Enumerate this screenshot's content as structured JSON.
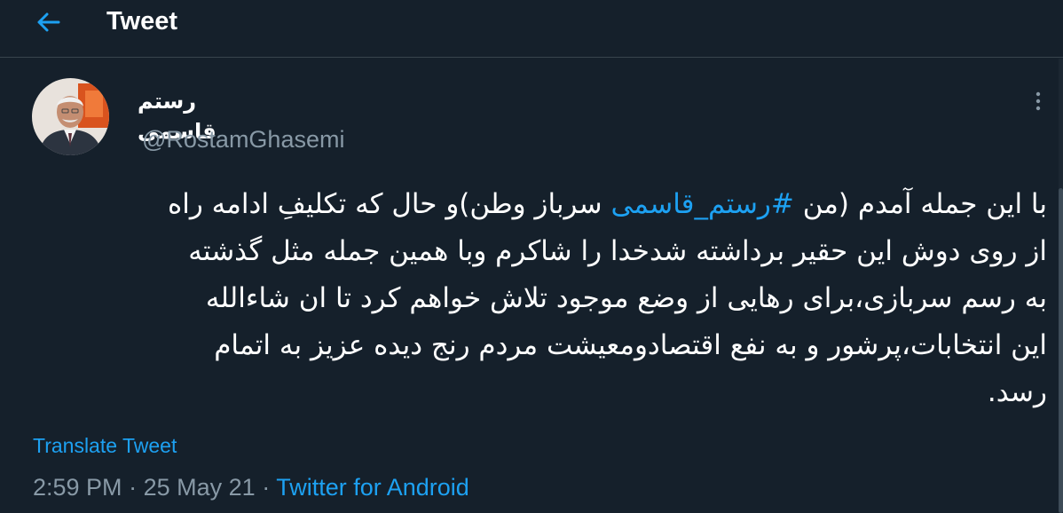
{
  "header": {
    "title": "Tweet",
    "back_icon": "arrow-left-icon"
  },
  "tweet": {
    "author": {
      "display_name": "رستم قاسمی",
      "handle": "@RostamGhasemi"
    },
    "more_icon": "more-vertical-icon",
    "text": {
      "line1_before": "با این جمله آمدم (من ",
      "hashtag": "#رستم_قاسمی",
      "line1_after": " سرباز وطن)و حال که تکلیفِ ادامه راه",
      "line2": "از روی دوش این حقیر برداشته شدخدا را شاکرم وبا همین جمله مثل گذشته",
      "line3": "به رسم سربازی،برای رهایی از وضع موجود تلاش خواهم کرد تا ان شاءالله",
      "line4": "این انتخابات،پرشور و به نفع اقتصادومعیشت مردم رنج دیده عزیز به اتمام",
      "line5": "رسد."
    },
    "translate_label": "Translate Tweet",
    "time": "2:59 PM",
    "separator": "·",
    "date": "25 May 21",
    "source": "Twitter for Android"
  },
  "colors": {
    "background": "#15202b",
    "accent": "#1da1f2",
    "secondary_text": "#8899a6",
    "divider": "#38444d"
  }
}
